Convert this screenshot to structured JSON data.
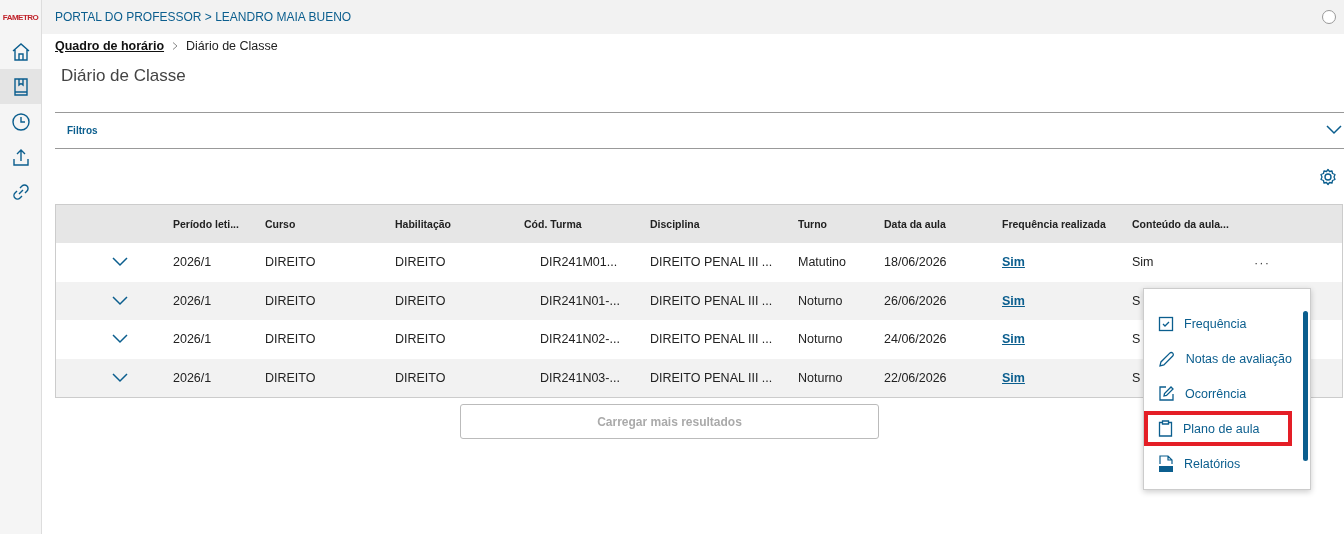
{
  "sidebar": {
    "logo": "FAMETRO",
    "items": [
      {
        "kind": "home",
        "selected": false
      },
      {
        "kind": "book",
        "selected": true
      },
      {
        "kind": "clock",
        "selected": false
      },
      {
        "kind": "upload",
        "selected": false
      },
      {
        "kind": "link",
        "selected": false
      }
    ]
  },
  "header": {
    "title": "PORTAL DO PROFESSOR > LEANDRO MAIA BUENO"
  },
  "breadcrumb": [
    {
      "label": "Quadro de horário",
      "kind": "link"
    },
    {
      "label": "Diário de Classe",
      "kind": "current"
    }
  ],
  "page_title": "Diário de Classe",
  "filters": {
    "label": "Filtros",
    "expanded": false
  },
  "table": {
    "columns": [
      "Período leti...",
      "Curso",
      "Habilitação",
      "Cód. Turma",
      "Disciplina",
      "Turno",
      "Data da aula",
      "Frequência realizada",
      "Conteúdo da aula..."
    ],
    "rows": [
      {
        "cells": [
          "2026/1",
          "DIREITO",
          "DIREITO",
          "DIR241M01...",
          "DIREITO PENAL III ...",
          "Matutino",
          "18/06/2026",
          "Sim",
          "Sim"
        ],
        "more": "···"
      },
      {
        "cells": [
          "2026/1",
          "DIREITO",
          "DIREITO",
          "DIR241N01-...",
          "DIREITO PENAL III ...",
          "Noturno",
          "26/06/2026",
          "Sim",
          "S"
        ]
      },
      {
        "cells": [
          "2026/1",
          "DIREITO",
          "DIREITO",
          "DIR241N02-...",
          "DIREITO PENAL III ...",
          "Noturno",
          "24/06/2026",
          "Sim",
          "S"
        ]
      },
      {
        "cells": [
          "2026/1",
          "DIREITO",
          "DIREITO",
          "DIR241N03-...",
          "DIREITO PENAL III ...",
          "Noturno",
          "22/06/2026",
          "Sim",
          "S"
        ]
      }
    ]
  },
  "load_more": {
    "label": "Carregar mais resultados",
    "disabled": true
  },
  "context_menu": {
    "items": [
      {
        "kind": "checkbox",
        "label": "Frequência",
        "highlighted": false
      },
      {
        "kind": "pencil",
        "label": "Notas de avaliação",
        "highlighted": false
      },
      {
        "kind": "edit",
        "label": "Ocorrência",
        "highlighted": false
      },
      {
        "kind": "clipboard",
        "label": "Plano de aula",
        "highlighted": true
      },
      {
        "kind": "pdf",
        "label": "Relatórios",
        "highlighted": false
      }
    ]
  }
}
